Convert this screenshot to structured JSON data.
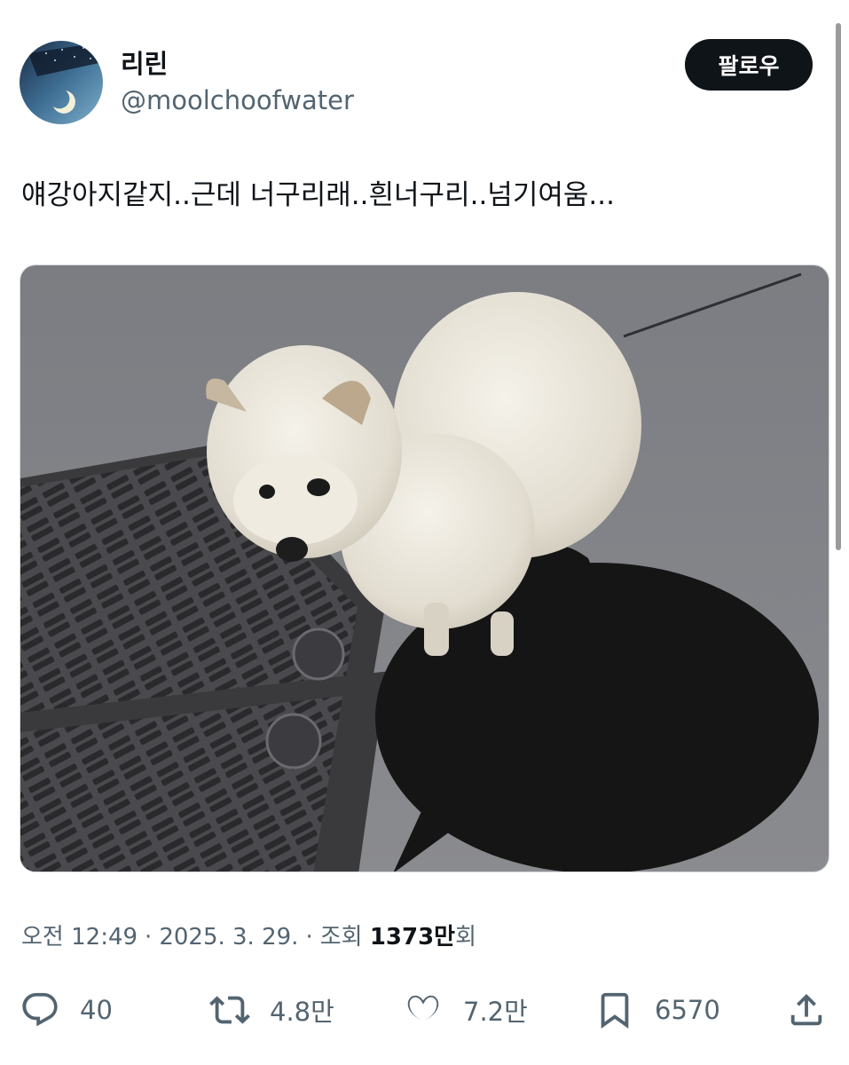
{
  "user": {
    "display_name": "리린",
    "handle": "@moolchoofwater",
    "avatar_icon": "moon-night-avatar"
  },
  "follow_label": "팔로우",
  "tweet": {
    "text": "얘강아지같지..근데 너구리래..흰너구리..넘기여움...",
    "media_description_icon": "photo-white-raccoon-dog"
  },
  "meta": {
    "time": "오전 12:49",
    "date": "2025. 3. 29.",
    "views_label": "조회",
    "views_number": "1373만",
    "views_suffix": "회",
    "separator": "·"
  },
  "actions": {
    "replies": "40",
    "reposts": "4.8만",
    "likes": "7.2만",
    "bookmarks": "6570"
  },
  "colors": {
    "text_primary": "#0f1419",
    "text_secondary": "#536471",
    "button_bg": "#0f1419"
  }
}
